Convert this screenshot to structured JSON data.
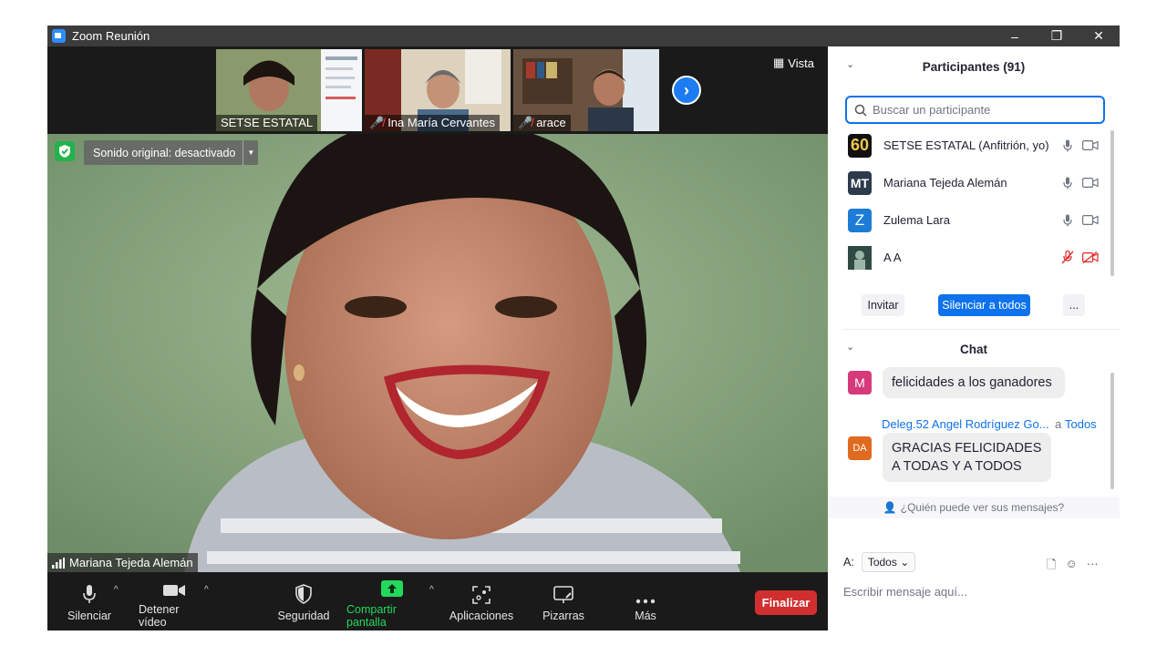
{
  "window": {
    "title": "Zoom Reunión",
    "controls": [
      "–",
      "❐",
      "✕"
    ]
  },
  "strip": {
    "thumbnails": [
      {
        "name": "SETSE ESTATAL",
        "muted": false
      },
      {
        "name": "Ina María Cervantes",
        "muted": true
      },
      {
        "name": "arace",
        "muted": true
      }
    ],
    "view_label": "Vista"
  },
  "main_video": {
    "original_sound": "Sonido original: desactivado",
    "speaker_name": "Mariana Tejeda Alemán"
  },
  "toolbar": {
    "mute": "Silenciar",
    "stop_video": "Detener vídeo",
    "security": "Seguridad",
    "share": "Compartir pantalla",
    "apps": "Aplicaciones",
    "whiteboards": "Pizarras",
    "more": "Más",
    "end": "Finalizar"
  },
  "participants": {
    "header": "Participantes (91)",
    "search_placeholder": "Buscar un participante",
    "list": [
      {
        "name": "SETSE ESTATAL (Anfitrión, yo)",
        "avatar": "60",
        "avatar_color": "#111111",
        "audio_muted": false,
        "video_off": false
      },
      {
        "name": "Mariana Tejeda Alemán",
        "avatar": "MT",
        "avatar_color": "#2d3a4b",
        "audio_muted": false,
        "video_off": false
      },
      {
        "name": "Zulema Lara",
        "avatar": "Z",
        "avatar_color": "#1c7cd6",
        "audio_muted": false,
        "video_off": false
      },
      {
        "name": "A A",
        "avatar": "",
        "avatar_color": "#3a5a50",
        "audio_muted": true,
        "video_off": true
      }
    ],
    "invite": "Invitar",
    "mute_all": "Silenciar a todos",
    "more": "..."
  },
  "chat": {
    "header": "Chat",
    "messages": [
      {
        "avatar": "M",
        "avatar_color": "#d63a7a",
        "text": "felicidades a los ganadores"
      },
      {
        "avatar": "DA",
        "avatar_color": "#e06a1f",
        "sender": "Deleg.52 Angel Rodríguez Go...",
        "to_prefix": "a",
        "to": "Todos",
        "text": "GRACIAS FELICIDADES A TODAS Y A TODOS"
      }
    ],
    "who_can_see": "¿Quién puede ver sus mensajes?",
    "to_label": "A:",
    "to_value": "Todos",
    "input_placeholder": "Escribir mensaje aquí..."
  },
  "colors": {
    "accent": "#0e72ed",
    "end": "#d12f2f",
    "share": "#23d95c",
    "muted": "#ff4d4d"
  }
}
